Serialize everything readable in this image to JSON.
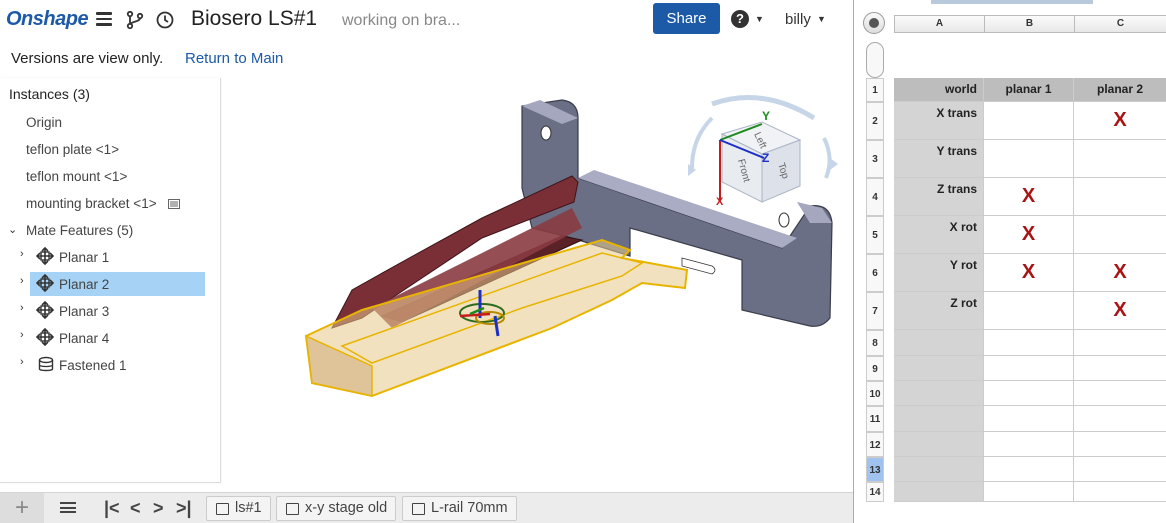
{
  "app": {
    "logo": "Onshape",
    "document_title": "Biosero LS#1",
    "document_subtitle": "working on bra...",
    "share_label": "Share",
    "help_label": "?",
    "user_name": "billy",
    "accent_color": "#1c5aa8"
  },
  "version_bar": {
    "message": "Versions are view only.",
    "return_link": "Return to Main"
  },
  "feature_tree": {
    "header": "Instances (3)",
    "instances": [
      {
        "label": "Origin"
      },
      {
        "label": "teflon plate <1>"
      },
      {
        "label": "teflon mount <1>"
      },
      {
        "label": "mounting bracket <1>"
      }
    ],
    "mate_group": "Mate Features (5)",
    "mates": [
      {
        "label": "Planar 1",
        "icon": "planar-mate-icon",
        "selected": false
      },
      {
        "label": "Planar 2",
        "icon": "planar-mate-icon",
        "selected": true
      },
      {
        "label": "Planar 3",
        "icon": "planar-mate-icon",
        "selected": false
      },
      {
        "label": "Planar 4",
        "icon": "planar-mate-icon",
        "selected": false
      },
      {
        "label": "Fastened 1",
        "icon": "fastened-mate-icon",
        "selected": false
      }
    ]
  },
  "view_cube": {
    "axis_y": "Y",
    "axis_z": "Z",
    "axis_x": "X",
    "face_top": "Top",
    "face_front": "Front",
    "face_left": "Left"
  },
  "tabs": [
    {
      "label": "ls#1"
    },
    {
      "label": "x-y stage old"
    },
    {
      "label": "L-rail 70mm"
    }
  ],
  "bottom_bar": {
    "add_label": "+",
    "first_label": "|<",
    "prev_label": "<",
    "next_label": ">",
    "last_label": ">|"
  },
  "spreadsheet": {
    "columns": [
      "A",
      "B",
      "C"
    ],
    "rows": [
      {
        "num": "1",
        "a": "world",
        "b": "planar 1",
        "c": "planar 2"
      },
      {
        "num": "2",
        "a": "X trans",
        "b": "",
        "c": "X"
      },
      {
        "num": "3",
        "a": "Y trans",
        "b": "",
        "c": ""
      },
      {
        "num": "4",
        "a": "Z trans",
        "b": "X",
        "c": ""
      },
      {
        "num": "5",
        "a": "X rot",
        "b": "X",
        "c": ""
      },
      {
        "num": "6",
        "a": "Y rot",
        "b": "X",
        "c": "X"
      },
      {
        "num": "7",
        "a": "Z rot",
        "b": "",
        "c": "X"
      },
      {
        "num": "8",
        "a": "",
        "b": "",
        "c": ""
      },
      {
        "num": "9",
        "a": "",
        "b": "",
        "c": ""
      },
      {
        "num": "10",
        "a": "",
        "b": "",
        "c": ""
      },
      {
        "num": "11",
        "a": "",
        "b": "",
        "c": ""
      },
      {
        "num": "12",
        "a": "",
        "b": "",
        "c": ""
      },
      {
        "num": "13",
        "a": "",
        "b": "",
        "c": ""
      },
      {
        "num": "14",
        "a": "",
        "b": "",
        "c": ""
      }
    ],
    "active_row": "13",
    "mark_color": "#a81313"
  }
}
